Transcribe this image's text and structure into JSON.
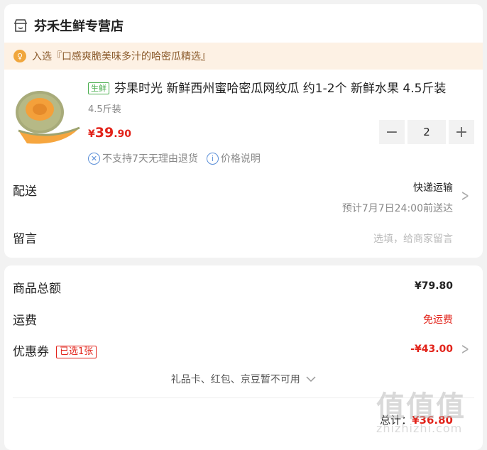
{
  "store": {
    "name": "芬禾生鲜专营店",
    "icon": "store-icon"
  },
  "notice": {
    "text": "入选『口感爽脆美味多汁的哈密瓜精选』",
    "icon": "award-icon"
  },
  "product": {
    "tag": "生鲜",
    "title": "芬果时光 新鲜西州蜜哈密瓜网纹瓜 约1-2个 新鲜水果 4.5斤装",
    "spec": "4.5斤装",
    "price_symbol": "¥",
    "price_int": "39",
    "price_dec": ".90",
    "quantity": "2",
    "minus": "−",
    "plus": "+"
  },
  "policies": [
    {
      "icon": "no-return-icon",
      "glyph": "✕",
      "text": "不支持7天无理由退货"
    },
    {
      "icon": "info-icon",
      "glyph": "i",
      "text": "价格说明"
    }
  ],
  "delivery": {
    "label": "配送",
    "method": "快递运输",
    "eta": "预计7月7日24:00前送达"
  },
  "message": {
    "label": "留言",
    "placeholder": "选填，给商家留言"
  },
  "summary": {
    "subtotal_label": "商品总额",
    "subtotal": "¥79.80",
    "shipping_label": "运费",
    "shipping": "免运费",
    "coupon_label": "优惠券",
    "coupon_tag": "已选1张",
    "coupon_value": "-¥43.00",
    "gift_note": "礼品卡、红包、京豆暂不可用",
    "total_label": "总计：",
    "total": "¥36.80"
  },
  "watermark": {
    "chars": "值值值",
    "sub": "zhizhizhi.com"
  },
  "colors": {
    "accent": "#e2231a",
    "fresh": "#4caf50",
    "notice_bg": "#fdf1e4"
  }
}
